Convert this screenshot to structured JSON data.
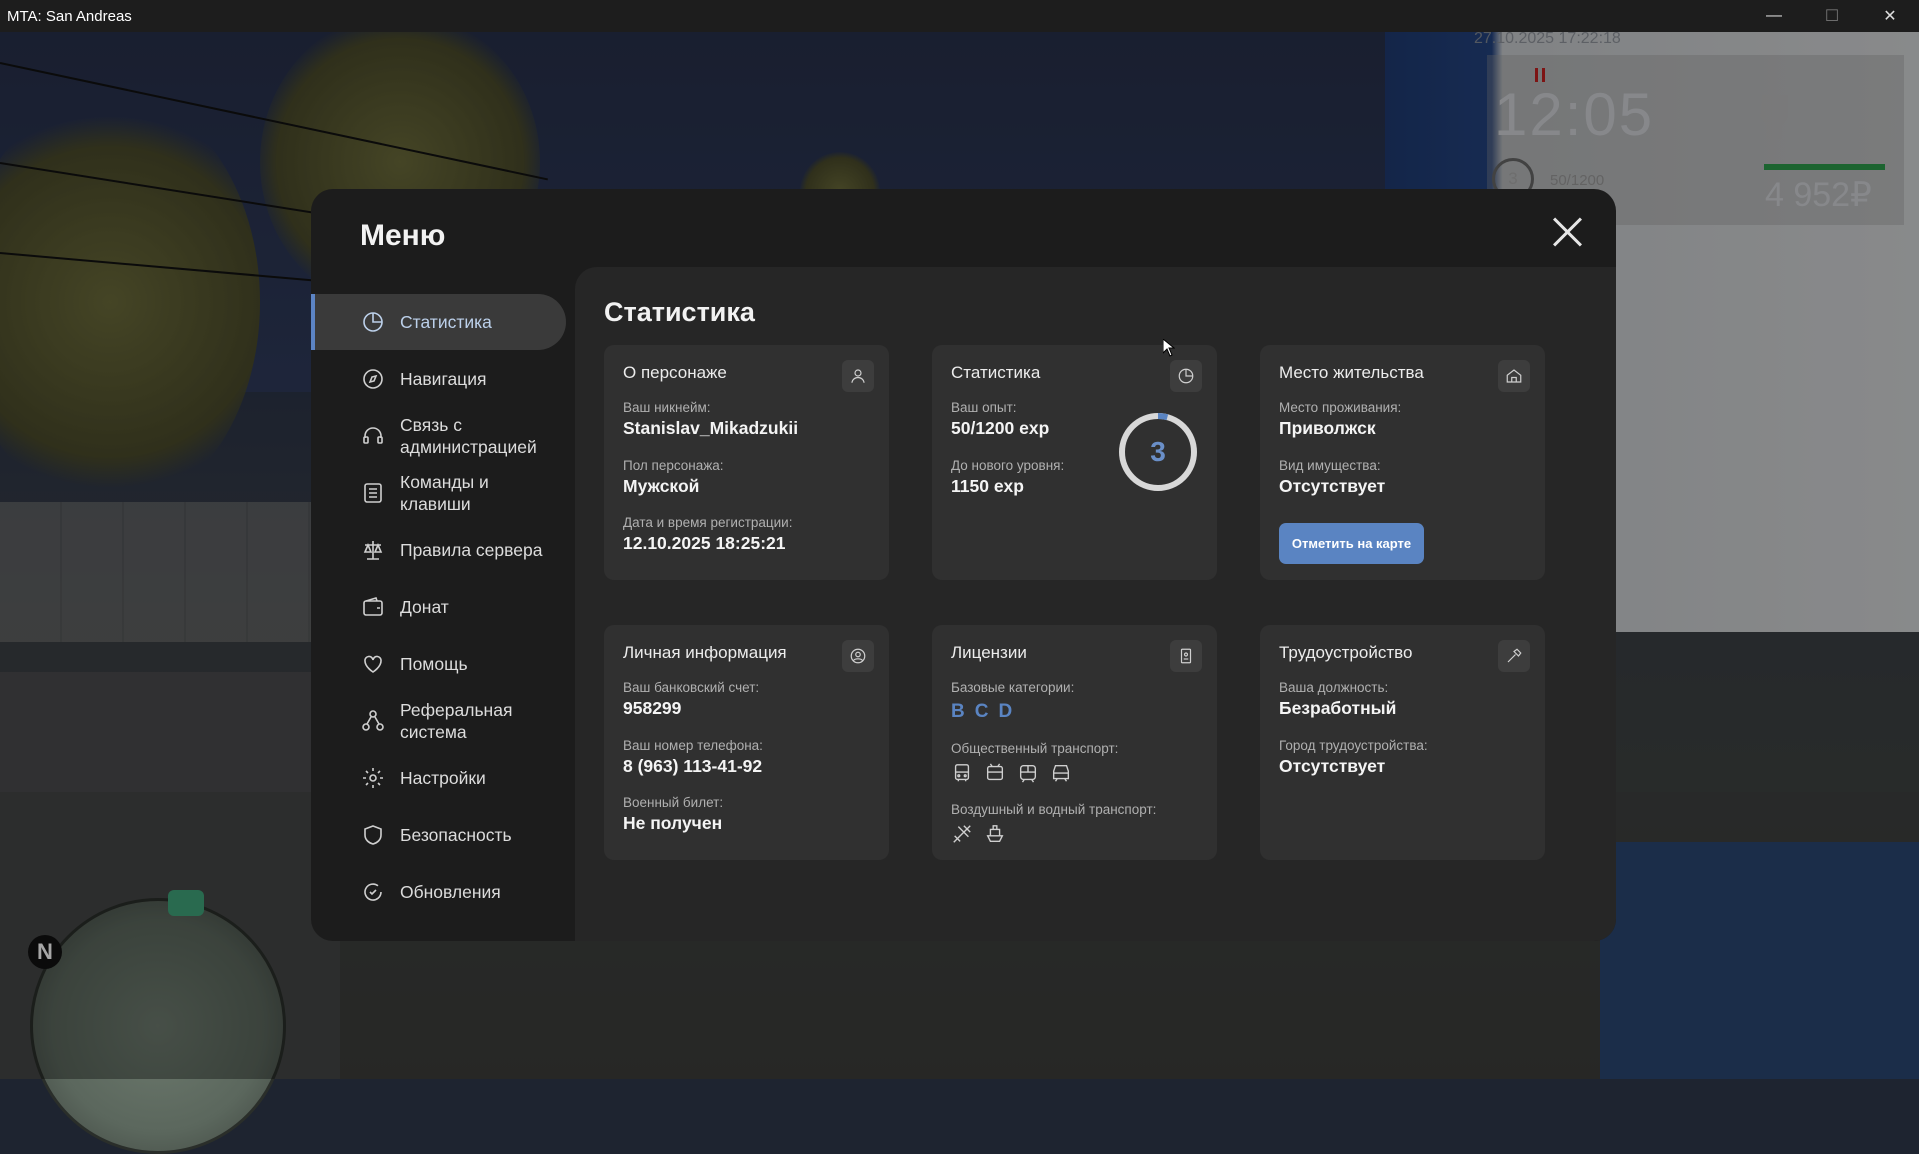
{
  "window": {
    "title": "MTA: San Andreas",
    "minimize": "—",
    "maximize": "☐",
    "close": "✕"
  },
  "hud": {
    "datetime": "27.10.2025 17:22:18",
    "clock": "12:05",
    "level": "3",
    "exp": "50/1200",
    "money": "4 952₽",
    "minimap_north": "N"
  },
  "menu": {
    "title": "Меню",
    "nav": [
      {
        "label": "Статистика",
        "icon": "chart-icon",
        "active": true
      },
      {
        "label": "Навигация",
        "icon": "compass-icon"
      },
      {
        "label": "Связь с администрацией",
        "icon": "headset-icon"
      },
      {
        "label": "Команды и клавиши",
        "icon": "list-icon"
      },
      {
        "label": "Правила сервера",
        "icon": "scales-icon"
      },
      {
        "label": "Донат",
        "icon": "wallet-icon"
      },
      {
        "label": "Помощь",
        "icon": "heart-hands-icon"
      },
      {
        "label": "Реферальная система",
        "icon": "network-icon"
      },
      {
        "label": "Настройки",
        "icon": "gear-icon"
      },
      {
        "label": "Безопасность",
        "icon": "shield-icon"
      },
      {
        "label": "Обновления",
        "icon": "refresh-check-icon"
      }
    ]
  },
  "content": {
    "title": "Статистика",
    "character": {
      "title": "О персонаже",
      "nickname_label": "Ваш никнейм:",
      "nickname": "Stanislav_Mikadzukii",
      "gender_label": "Пол персонажа:",
      "gender": "Мужской",
      "regdate_label": "Дата и время регистрации:",
      "regdate": "12.10.2025 18:25:21"
    },
    "stats": {
      "title": "Статистика",
      "exp_label": "Ваш опыт:",
      "exp": "50/1200 exp",
      "next_label": "До нового уровня:",
      "next": "1150 exp",
      "level": "3",
      "progress": 0.042
    },
    "residence": {
      "title": "Место жительства",
      "place_label": "Место проживания:",
      "place": "Приволжск",
      "property_label": "Вид имущества:",
      "property": "Отсутствует",
      "map_button": "Отметить на карте"
    },
    "personal": {
      "title": "Личная информация",
      "bank_label": "Ваш банковский счет:",
      "bank": "958299",
      "phone_label": "Ваш номер телефона:",
      "phone": "8 (963) 113-41-92",
      "military_label": "Военный билет:",
      "military": "Не получен"
    },
    "licenses": {
      "title": "Лицензии",
      "basic_label": "Базовые категории:",
      "basic": [
        "B",
        "C",
        "D"
      ],
      "public_label": "Общественный транспорт:",
      "air_water_label": "Воздушный и водный транспорт:"
    },
    "employment": {
      "title": "Трудоустройство",
      "position_label": "Ваша должность:",
      "position": "Безработный",
      "city_label": "Город трудоустройства:",
      "city": "Отсутствует"
    }
  },
  "colors": {
    "accent": "#5a84c2",
    "modal_bg": "#1c1c1c",
    "panel_bg": "#262626",
    "card_bg": "#303030"
  }
}
